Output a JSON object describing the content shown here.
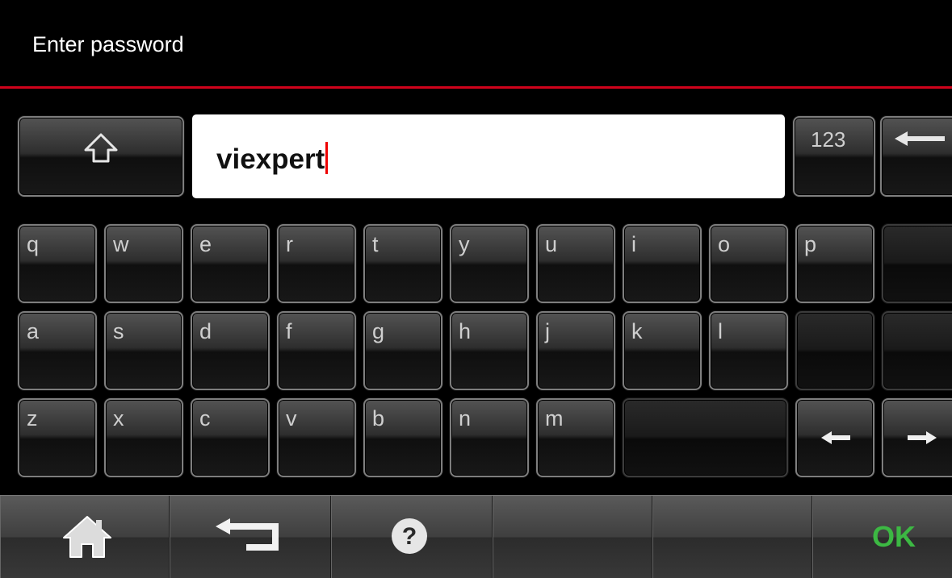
{
  "header": {
    "title": "Enter password"
  },
  "password_field": {
    "value": "viexpert"
  },
  "keys": {
    "numeric_toggle": "123",
    "row1": [
      "q",
      "w",
      "e",
      "r",
      "t",
      "y",
      "u",
      "i",
      "o",
      "p"
    ],
    "row2": [
      "a",
      "s",
      "d",
      "f",
      "g",
      "h",
      "j",
      "k",
      "l"
    ],
    "row3": [
      "z",
      "x",
      "c",
      "v",
      "b",
      "n",
      "m"
    ]
  },
  "bottom_bar": {
    "ok_label": "OK"
  },
  "colors": {
    "accent_red": "#d0021b",
    "ok_green": "#3cb843",
    "caret": "#e00000"
  },
  "icons": [
    "shift-icon",
    "backspace-icon",
    "cursor-left-icon",
    "cursor-right-icon",
    "home-icon",
    "back-icon",
    "help-icon"
  ]
}
